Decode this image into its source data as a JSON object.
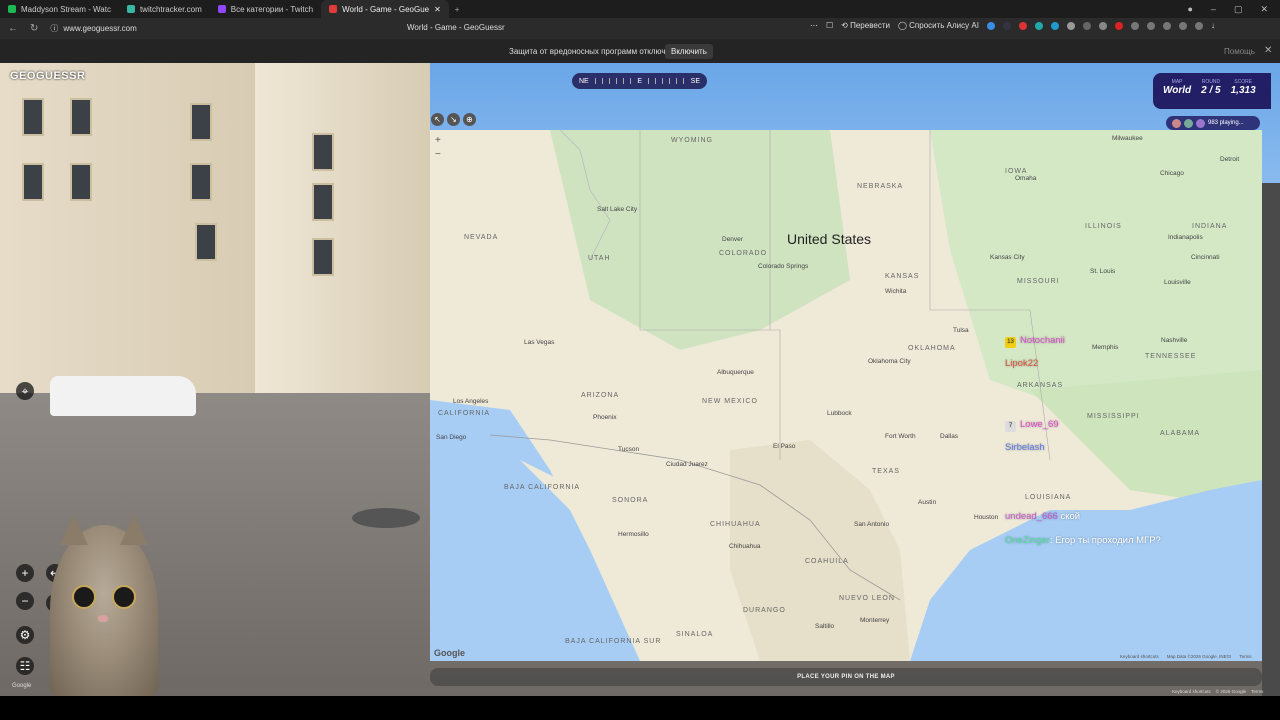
{
  "browser": {
    "tabs": [
      {
        "title": "Maddyson Stream - Watc",
        "color": "#1db954"
      },
      {
        "title": "twitchtracker.com",
        "color": "#3ab6a6"
      },
      {
        "title": "Все категории - Twitch",
        "color": "#9146ff"
      },
      {
        "title": "World - Game - GeoGue",
        "color": "#e03c3c"
      }
    ],
    "url": "www.geoguessr.com",
    "page_title": "World - Game - GeoGuessr",
    "translate_label": "Перевести",
    "alice_label": "Спросить Алису AI",
    "notice_text": "Защита от вредоносных программ отключена",
    "notice_button": "Включить",
    "notice_help": "Помощь"
  },
  "game": {
    "logo": "GEOGUESSR",
    "compass": {
      "left": "NE",
      "center": "E",
      "right": "SE"
    },
    "map_label": "MAP",
    "map_value": "World",
    "round_label": "ROUND",
    "round_value": "2 / 5",
    "score_label": "SCORE",
    "score_value": "1,313",
    "playing": "983 playing...",
    "place_pin": "PLACE YOUR PIN ON THE MAP"
  },
  "map": {
    "country": "United States",
    "google": "Google",
    "footer": [
      "Keyboard shortcuts",
      "Map Data ©2026 Google, INEGI",
      "Terms"
    ],
    "states": [
      "WYOMING",
      "NEBRASKA",
      "IOWA",
      "ILLINOIS",
      "INDIANA",
      "NEVADA",
      "UTAH",
      "COLORADO",
      "KANSAS",
      "MISSOURI",
      "OKLAHOMA",
      "ARIZONA",
      "NEW MEXICO",
      "ARKANSAS",
      "TENNESSEE",
      "MISSISSIPPI",
      "ALABAMA",
      "TEXAS",
      "LOUISIANA",
      "CALIFORNIA",
      "BAJA CALIFORNIA",
      "SONORA",
      "CHIHUAHUA",
      "COAHUILA",
      "NUEVO LEON",
      "SINALOA",
      "DURANGO",
      "BAJA CALIFORNIA SUR"
    ],
    "cities": [
      "Denver",
      "Salt Lake City",
      "Las Vegas",
      "Los Angeles",
      "San Diego",
      "Phoenix",
      "Tucson",
      "Albuquerque",
      "Oklahoma City",
      "Dallas",
      "Fort Worth",
      "Austin",
      "San Antonio",
      "Houston",
      "Kansas City",
      "St. Louis",
      "Chicago",
      "Milwaukee",
      "Detroit",
      "Indianapolis",
      "Cincinnati",
      "Louisville",
      "Memphis",
      "Nashville",
      "Ciudad Juarez",
      "Hermosillo",
      "Chihuahua",
      "Monterrey",
      "Saltillo",
      "Colorado Springs",
      "Omaha",
      "Wichita",
      "Tulsa",
      "Lubbock",
      "El Paso"
    ]
  },
  "scene_footer": {
    "google": "Google",
    "links": [
      "Keyboard shortcuts",
      "© 2026 Google",
      "Terms"
    ]
  },
  "chat": [
    {
      "badge": "13",
      "user": "Notochanii",
      "color": "#e24bd0",
      "message": ""
    },
    {
      "badge": "",
      "user": "Lipok22",
      "color": "#e0503a",
      "message": ""
    },
    {
      "badge": "7",
      "user": "Lowe_69",
      "color": "#e24bd0",
      "message": ""
    },
    {
      "badge": "",
      "user": "Sirbelash",
      "color": "#5a7ae8",
      "message": ""
    },
    {
      "badge": "",
      "user": "undead_666",
      "color": "#c45ad0",
      "message": "ской"
    },
    {
      "badge": "",
      "user": "OneZinger",
      "color": "#55e0a0",
      "message": ": Егор ты проходил МГР?"
    }
  ]
}
